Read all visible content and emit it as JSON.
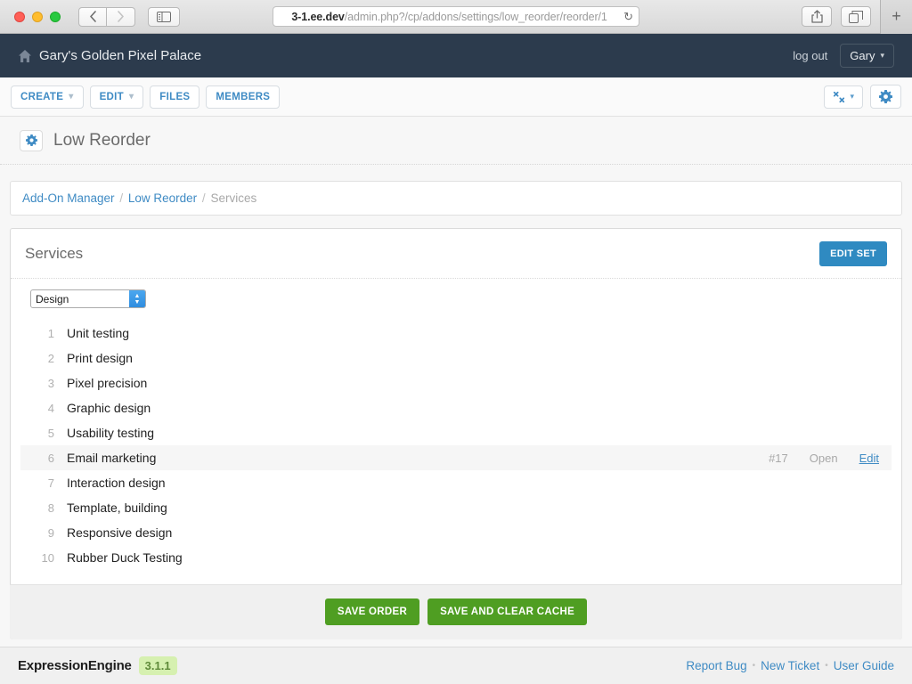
{
  "browser": {
    "url_prefix": "3-1.ee.dev",
    "url_rest": "/admin.php?/cp/addons/settings/low_reorder/reorder/1",
    "reload_icon": "reload-icon",
    "shield_icon": "info-icon",
    "back_icon": "chevron-left-icon",
    "forward_icon": "chevron-right-icon",
    "sidebar_icon": "sidebar-toggle-icon",
    "share_icon": "share-icon",
    "tabs_icon": "show-all-tabs-icon",
    "new_tab_label": "+"
  },
  "header": {
    "home_icon": "home-icon",
    "site_title": "Gary's Golden Pixel Palace",
    "logout_label": "log out",
    "user_label": "Gary",
    "user_caret": "⌄"
  },
  "toolbar": {
    "items": [
      {
        "label": "CREATE",
        "caret": true
      },
      {
        "label": "EDIT",
        "caret": true
      },
      {
        "label": "FILES",
        "caret": false
      },
      {
        "label": "MEMBERS",
        "caret": false
      }
    ],
    "tools_icon": "wrench-icon",
    "tools_caret": "⌄",
    "settings_icon": "gear-icon"
  },
  "page": {
    "icon": "gear-icon",
    "title": "Low Reorder"
  },
  "breadcrumb": {
    "items": [
      {
        "label": "Add-On Manager",
        "link": true
      },
      {
        "label": "Low Reorder",
        "link": true
      },
      {
        "label": "Services",
        "link": false
      }
    ],
    "separator": "/"
  },
  "panel": {
    "title": "Services",
    "edit_set_label": "EDIT SET",
    "select": {
      "value": "Design",
      "options": [
        "Design"
      ]
    },
    "rows": [
      {
        "num": "1",
        "label": "Unit testing",
        "id": "",
        "status": "",
        "edit": "",
        "active": false
      },
      {
        "num": "2",
        "label": "Print design",
        "id": "",
        "status": "",
        "edit": "",
        "active": false
      },
      {
        "num": "3",
        "label": "Pixel precision",
        "id": "",
        "status": "",
        "edit": "",
        "active": false
      },
      {
        "num": "4",
        "label": "Graphic design",
        "id": "",
        "status": "",
        "edit": "",
        "active": false
      },
      {
        "num": "5",
        "label": "Usability testing",
        "id": "",
        "status": "",
        "edit": "",
        "active": false
      },
      {
        "num": "6",
        "label": "Email marketing",
        "id": "#17",
        "status": "Open",
        "edit": "Edit",
        "active": true
      },
      {
        "num": "7",
        "label": "Interaction design",
        "id": "",
        "status": "",
        "edit": "",
        "active": false
      },
      {
        "num": "8",
        "label": "Template, building",
        "id": "",
        "status": "",
        "edit": "",
        "active": false
      },
      {
        "num": "9",
        "label": "Responsive design",
        "id": "",
        "status": "",
        "edit": "",
        "active": false
      },
      {
        "num": "10",
        "label": "Rubber Duck Testing",
        "id": "",
        "status": "",
        "edit": "",
        "active": false
      }
    ],
    "save_order_label": "SAVE ORDER",
    "save_clear_label": "SAVE AND CLEAR CACHE"
  },
  "footer": {
    "brand": "ExpressionEngine",
    "version": "3.1.1",
    "links": [
      "Report Bug",
      "New Ticket",
      "User Guide"
    ],
    "separator": "•"
  },
  "colors": {
    "header_bg": "#2c3b4d",
    "accent_blue": "#3f8bc4",
    "button_blue": "#2f8ac1",
    "button_green": "#4f9e22",
    "version_badge_bg": "#d6f0b0"
  }
}
